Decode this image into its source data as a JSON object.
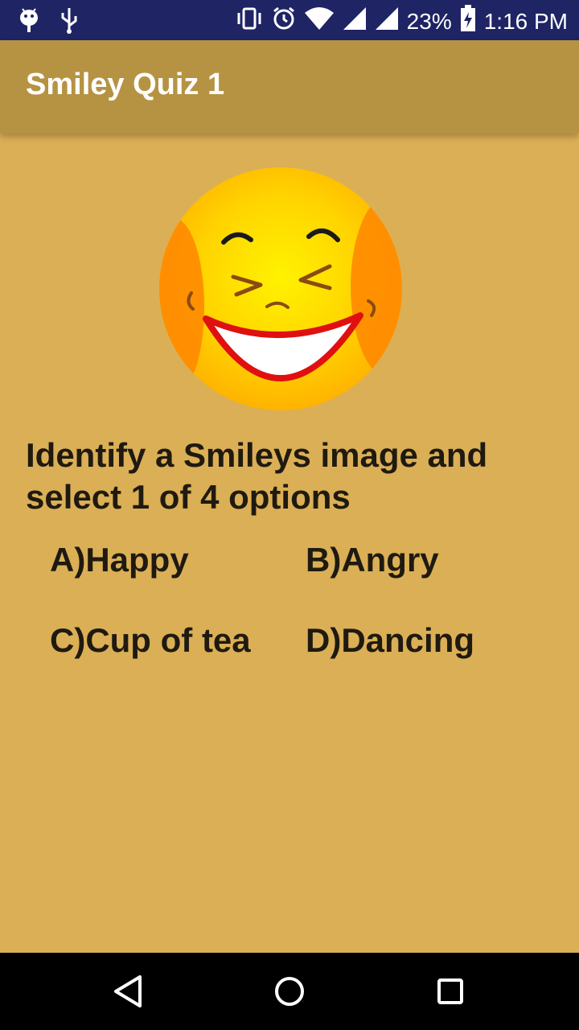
{
  "status_bar": {
    "battery": "23%",
    "time": "1:16 PM"
  },
  "app_bar": {
    "title": "Smiley Quiz 1"
  },
  "quiz": {
    "image_icon": "laughing-smiley",
    "question": "Identify a Smileys image and select 1 of 4 options",
    "options": [
      {
        "label": "A)Happy"
      },
      {
        "label": "B)Angry"
      },
      {
        "label": "C)Cup of tea"
      },
      {
        "label": "D)Dancing"
      }
    ]
  },
  "colors": {
    "background": "#dbaf56",
    "app_bar": "#b69342",
    "status_bar": "#1e2464"
  }
}
